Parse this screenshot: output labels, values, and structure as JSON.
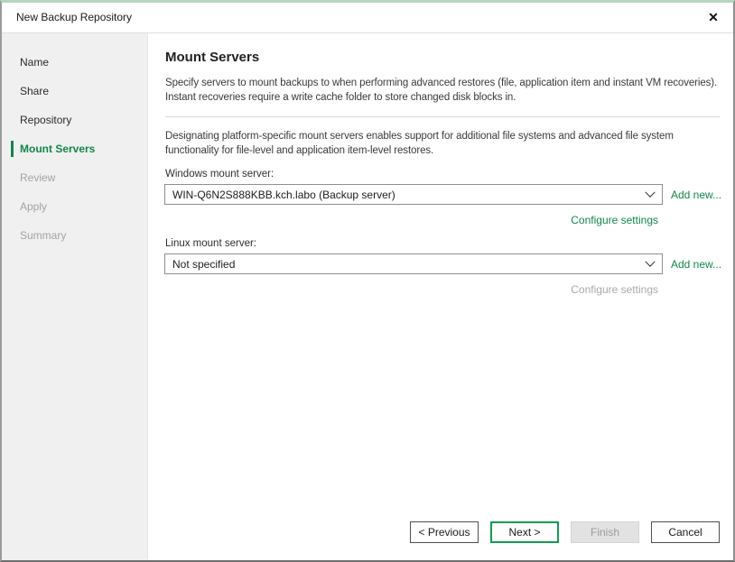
{
  "window": {
    "title": "New Backup Repository",
    "close_glyph": "✕"
  },
  "sidebar": {
    "items": [
      {
        "label": "Name",
        "state": "done"
      },
      {
        "label": "Share",
        "state": "done"
      },
      {
        "label": "Repository",
        "state": "done"
      },
      {
        "label": "Mount Servers",
        "state": "active"
      },
      {
        "label": "Review",
        "state": "pending"
      },
      {
        "label": "Apply",
        "state": "pending"
      },
      {
        "label": "Summary",
        "state": "pending"
      }
    ]
  },
  "content": {
    "heading": "Mount Servers",
    "description": "Specify servers to mount backups to when performing advanced restores (file, application item and instant VM recoveries). Instant recoveries require a write cache folder to store changed disk blocks in.",
    "note": "Designating platform-specific mount servers enables support for additional file systems and advanced file system functionality for file-level and application item-level restores.",
    "windows_mount": {
      "label": "Windows mount server:",
      "value": "WIN-Q6N2S888KBB.kch.labo (Backup server)",
      "add_new_label": "Add new...",
      "configure_label": "Configure settings",
      "configure_enabled": true
    },
    "linux_mount": {
      "label": "Linux mount server:",
      "value": "Not specified",
      "add_new_label": "Add new...",
      "configure_label": "Configure settings",
      "configure_enabled": false
    }
  },
  "footer": {
    "previous_label": "< Previous",
    "next_label": "Next >",
    "finish_label": "Finish",
    "cancel_label": "Cancel",
    "finish_enabled": false
  },
  "colors": {
    "accent_green": "#12854a",
    "next_button_border": "#159a52",
    "sidebar_bg": "#f0f0f0",
    "disabled_text": "#a3a3a3",
    "top_border": "#b7d4c0"
  }
}
